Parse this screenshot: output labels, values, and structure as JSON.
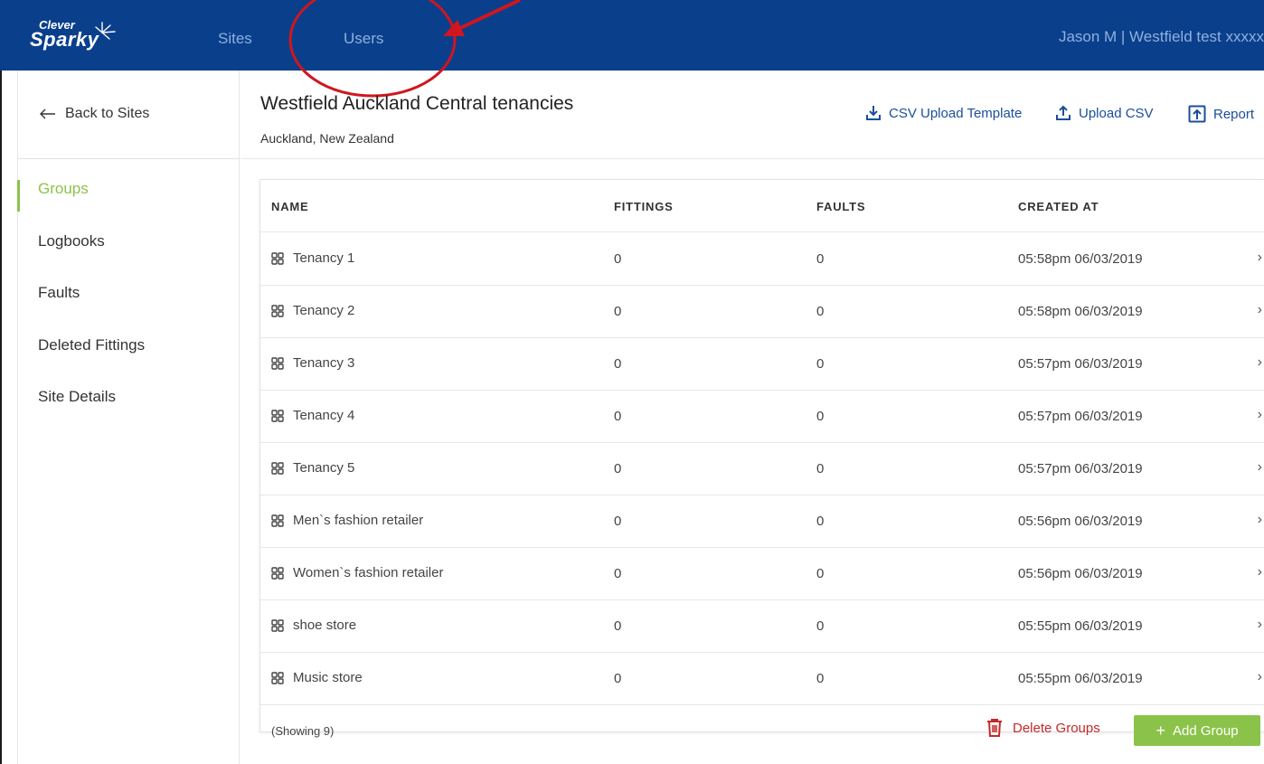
{
  "app": {
    "logo_small": "Clever",
    "logo_large": "Sparky"
  },
  "nav": {
    "sites": "Sites",
    "users": "Users",
    "user_info": "Jason M | Westfield test xxxxx"
  },
  "sidebar": {
    "back": "Back to Sites",
    "items": [
      {
        "label": "Groups",
        "active": true
      },
      {
        "label": "Logbooks"
      },
      {
        "label": "Faults"
      },
      {
        "label": "Deleted Fittings"
      },
      {
        "label": "Site Details"
      }
    ]
  },
  "header": {
    "title": "Westfield Auckland Central tenancies",
    "subtitle": "Auckland, New Zealand",
    "actions": {
      "csv_template": "CSV Upload Template",
      "upload_csv": "Upload CSV",
      "report": "Report"
    }
  },
  "table": {
    "columns": [
      "NAME",
      "FITTINGS",
      "FAULTS",
      "CREATED AT"
    ],
    "rows": [
      {
        "name": "Tenancy 1",
        "fittings": "0",
        "faults": "0",
        "created": "05:58pm 06/03/2019"
      },
      {
        "name": "Tenancy 2",
        "fittings": "0",
        "faults": "0",
        "created": "05:58pm 06/03/2019"
      },
      {
        "name": "Tenancy 3",
        "fittings": "0",
        "faults": "0",
        "created": "05:57pm 06/03/2019"
      },
      {
        "name": "Tenancy 4",
        "fittings": "0",
        "faults": "0",
        "created": "05:57pm 06/03/2019"
      },
      {
        "name": "Tenancy 5",
        "fittings": "0",
        "faults": "0",
        "created": "05:57pm 06/03/2019"
      },
      {
        "name": "Men`s fashion retailer",
        "fittings": "0",
        "faults": "0",
        "created": "05:56pm 06/03/2019"
      },
      {
        "name": "Women`s fashion retailer",
        "fittings": "0",
        "faults": "0",
        "created": "05:56pm 06/03/2019"
      },
      {
        "name": "shoe store",
        "fittings": "0",
        "faults": "0",
        "created": "05:55pm 06/03/2019"
      },
      {
        "name": "Music store",
        "fittings": "0",
        "faults": "0",
        "created": "05:55pm 06/03/2019"
      }
    ],
    "showing": "(Showing 9)",
    "delete_label": "Delete Groups",
    "add_label": "Add Group"
  },
  "colors": {
    "nav_bg": "#0a3f8c",
    "accent_green": "#8bc34a",
    "link_blue": "#1b4e9b",
    "danger_red": "#c62828",
    "annotation_red": "#d0161e"
  }
}
